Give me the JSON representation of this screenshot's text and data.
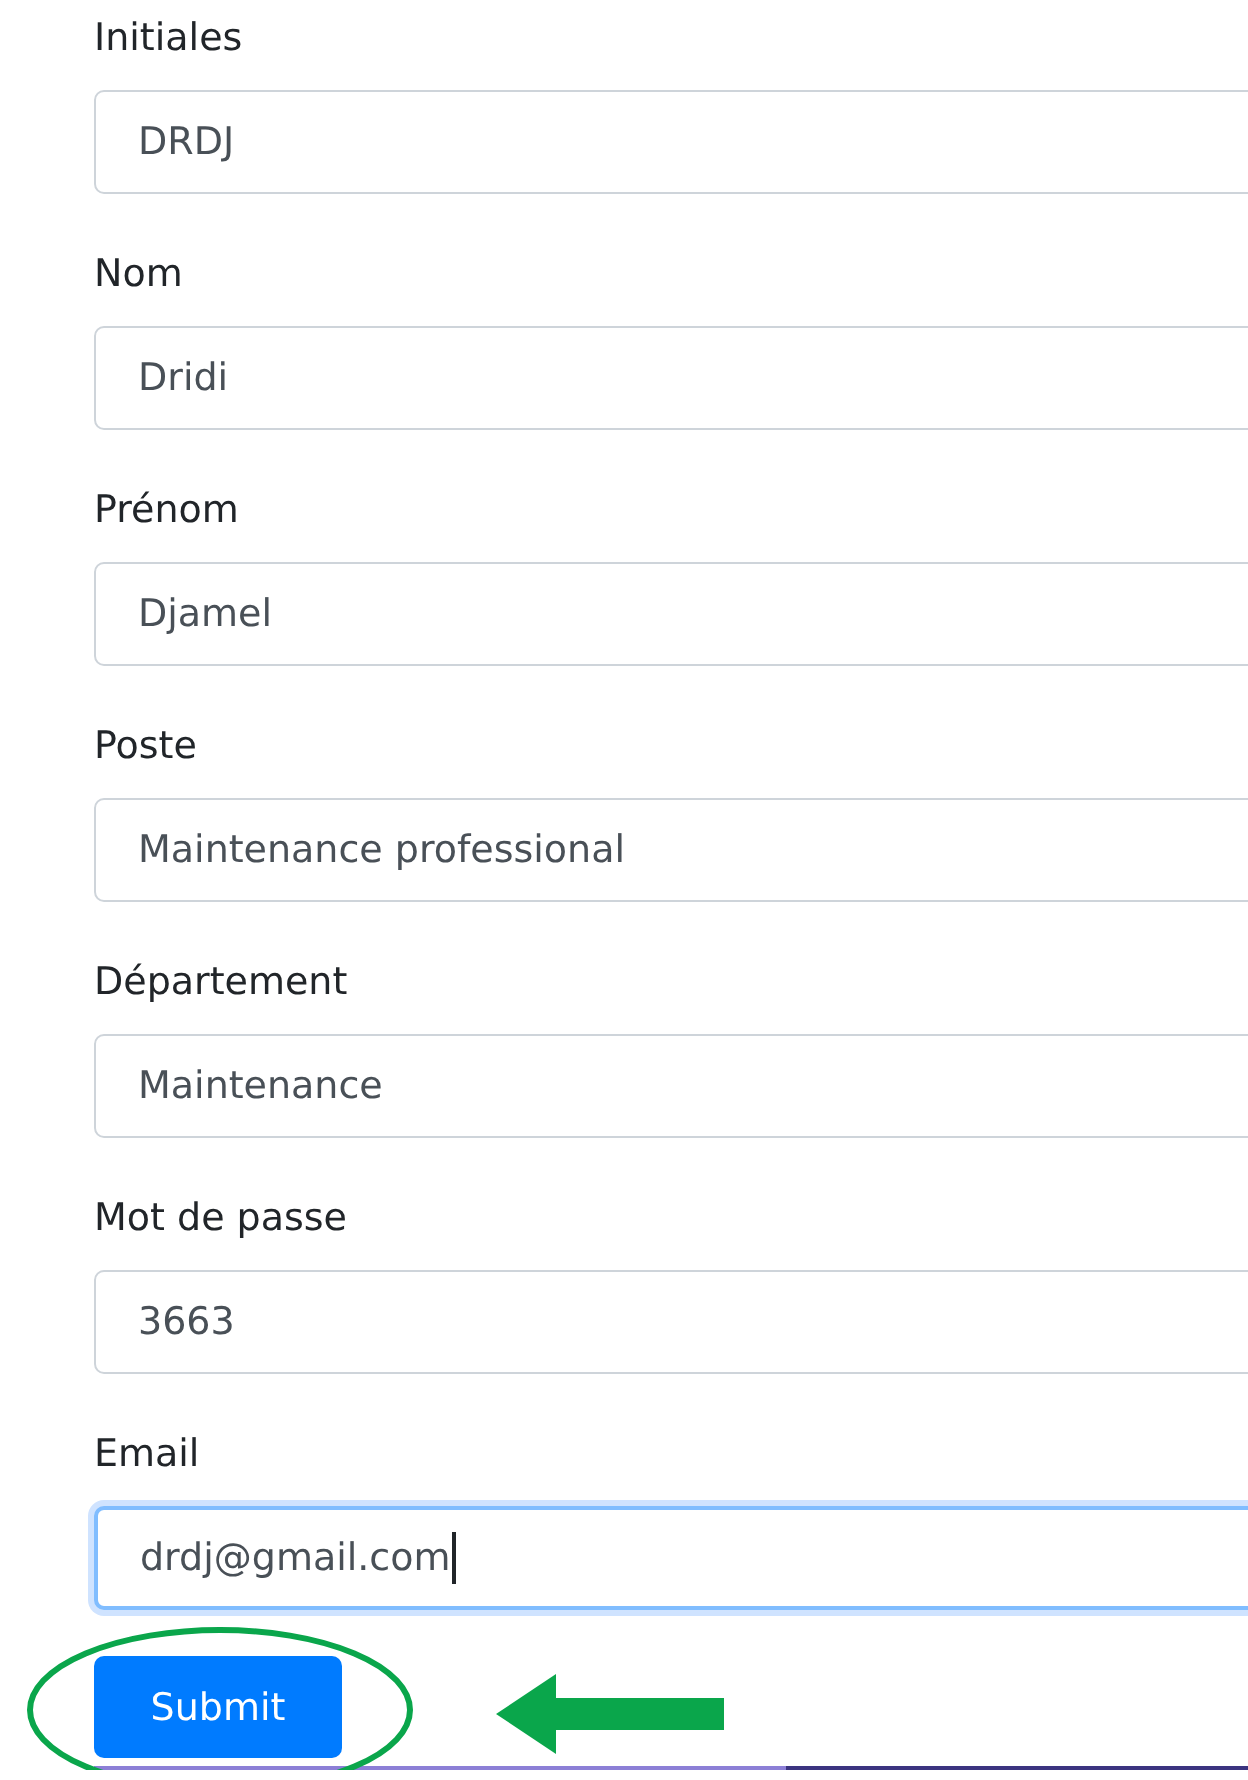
{
  "fields": [
    {
      "label": "Initiales",
      "value": "DRDJ",
      "focused": false
    },
    {
      "label": "Nom",
      "value": "Dridi",
      "focused": false
    },
    {
      "label": "Prénom",
      "value": "Djamel",
      "focused": false
    },
    {
      "label": "Poste",
      "value": "Maintenance professional",
      "focused": false
    },
    {
      "label": "Département",
      "value": "Maintenance",
      "focused": false
    },
    {
      "label": "Mot de passe",
      "value": "3663",
      "focused": false
    },
    {
      "label": "Email",
      "value": "drdj@gmail.com",
      "focused": true
    }
  ],
  "submit_button": {
    "label": "Submit"
  },
  "highlight_ellipse": {
    "color": "#0aa64b"
  },
  "pointer_arrow": {
    "color": "#0aa64b"
  }
}
